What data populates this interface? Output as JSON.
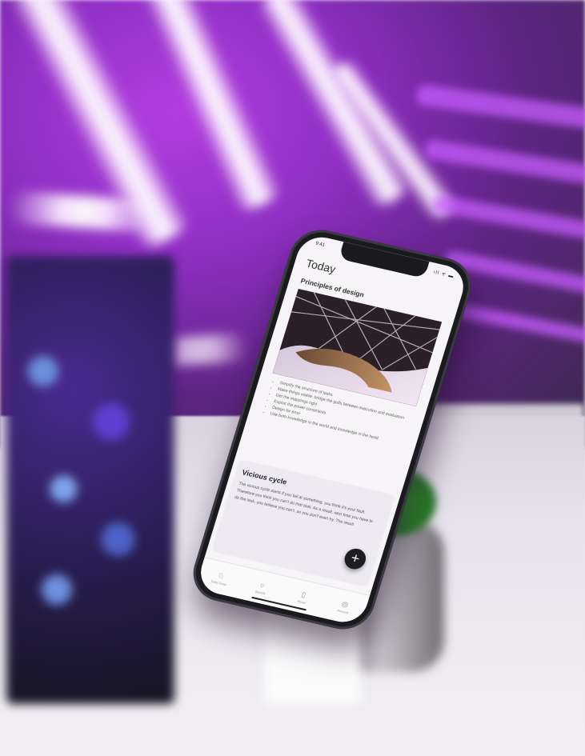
{
  "status_bar": {
    "time": "9:41",
    "icons": "ıll ᯤ ▬"
  },
  "app": {
    "title": "Today",
    "section_title": "Principles of design",
    "bullets": [
      "Simplify the structure of tasks.",
      "Make things visible: bridge the gulfs between execution and evaluation",
      "Get the mappings right",
      "Exploit the power constraints",
      "Design for error",
      "Use both knowledge in the world and knowledge in the head."
    ],
    "card": {
      "title": "Vicious cycle",
      "body": "The vicious cycle starts if you fail at something, you think it's your fault. Therefore you think you can't do that task. As a result, next time you have to do the task, you believe you can't, so you don't even try. The result"
    },
    "fab_label": "+",
    "tabs": [
      {
        "label": "Daily Dose",
        "icon": "♘"
      },
      {
        "label": "Search",
        "icon": "○"
      },
      {
        "label": "Read",
        "icon": "▯"
      },
      {
        "label": "Account",
        "icon": "◎"
      }
    ]
  },
  "colors": {
    "neon": "#c75cff",
    "background": "#8f2fc4",
    "phone": "#1b1b1f"
  }
}
